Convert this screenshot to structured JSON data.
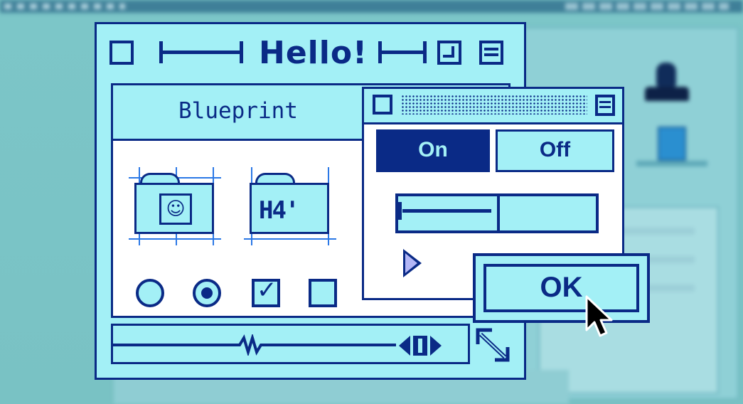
{
  "colors": {
    "accent": "#0a2a86",
    "fill": "#a3f0f6",
    "paper": "#ffffff",
    "grid": "#2b78e6",
    "desktop": "#7cc6c8"
  },
  "main_window": {
    "title": "Hello!",
    "header_label": "Blueprint",
    "folders": [
      {
        "name": "finder-folder",
        "icon": "finder-face-icon",
        "glyph": "☺"
      },
      {
        "name": "dimension-folder",
        "icon": "dimension-icon",
        "label": "H4'"
      }
    ],
    "controls": [
      {
        "type": "radio",
        "checked": false
      },
      {
        "type": "radio",
        "checked": true
      },
      {
        "type": "checkbox",
        "checked": true
      },
      {
        "type": "checkbox",
        "checked": false
      }
    ]
  },
  "popup_window": {
    "segments": {
      "on_label": "On",
      "off_label": "Off",
      "selected": "On"
    },
    "progress": 0.5
  },
  "ok_button": {
    "label": "OK"
  }
}
